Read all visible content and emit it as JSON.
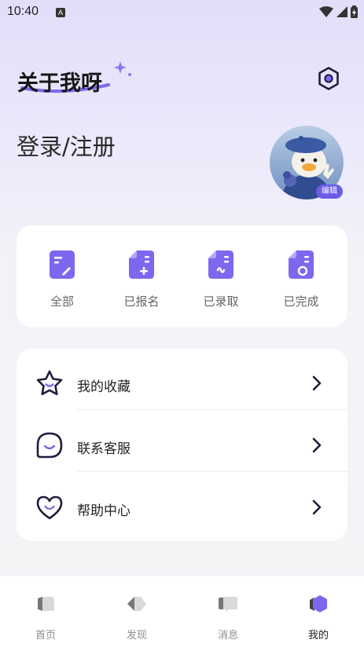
{
  "status_bar": {
    "time": "10:40",
    "badge": "A"
  },
  "header": {
    "logo_text": "关于我呀",
    "settings_icon": "hexagon-settings-icon"
  },
  "profile": {
    "login_text": "登录/注册",
    "edit_label": "编辑",
    "avatar": "duck-avatar"
  },
  "orders": [
    {
      "label": "全部",
      "icon": "doc-pen-icon"
    },
    {
      "label": "已报名",
      "icon": "doc-plus-icon"
    },
    {
      "label": "已录取",
      "icon": "doc-wave-icon"
    },
    {
      "label": "已完成",
      "icon": "doc-circle-icon"
    }
  ],
  "menu": [
    {
      "label": "我的收藏",
      "icon": "star-icon"
    },
    {
      "label": "联系客服",
      "icon": "chat-face-icon"
    },
    {
      "label": "帮助中心",
      "icon": "heart-icon"
    }
  ],
  "tabs": [
    {
      "label": "首页",
      "icon": "home-icon",
      "active": false
    },
    {
      "label": "发现",
      "icon": "discover-icon",
      "active": false
    },
    {
      "label": "消息",
      "icon": "message-icon",
      "active": false
    },
    {
      "label": "我的",
      "icon": "profile-icon",
      "active": true
    }
  ],
  "colors": {
    "accent": "#7b68ee",
    "accent_dark": "#6b5ce7",
    "icon_dark": "#1f1d3a"
  }
}
